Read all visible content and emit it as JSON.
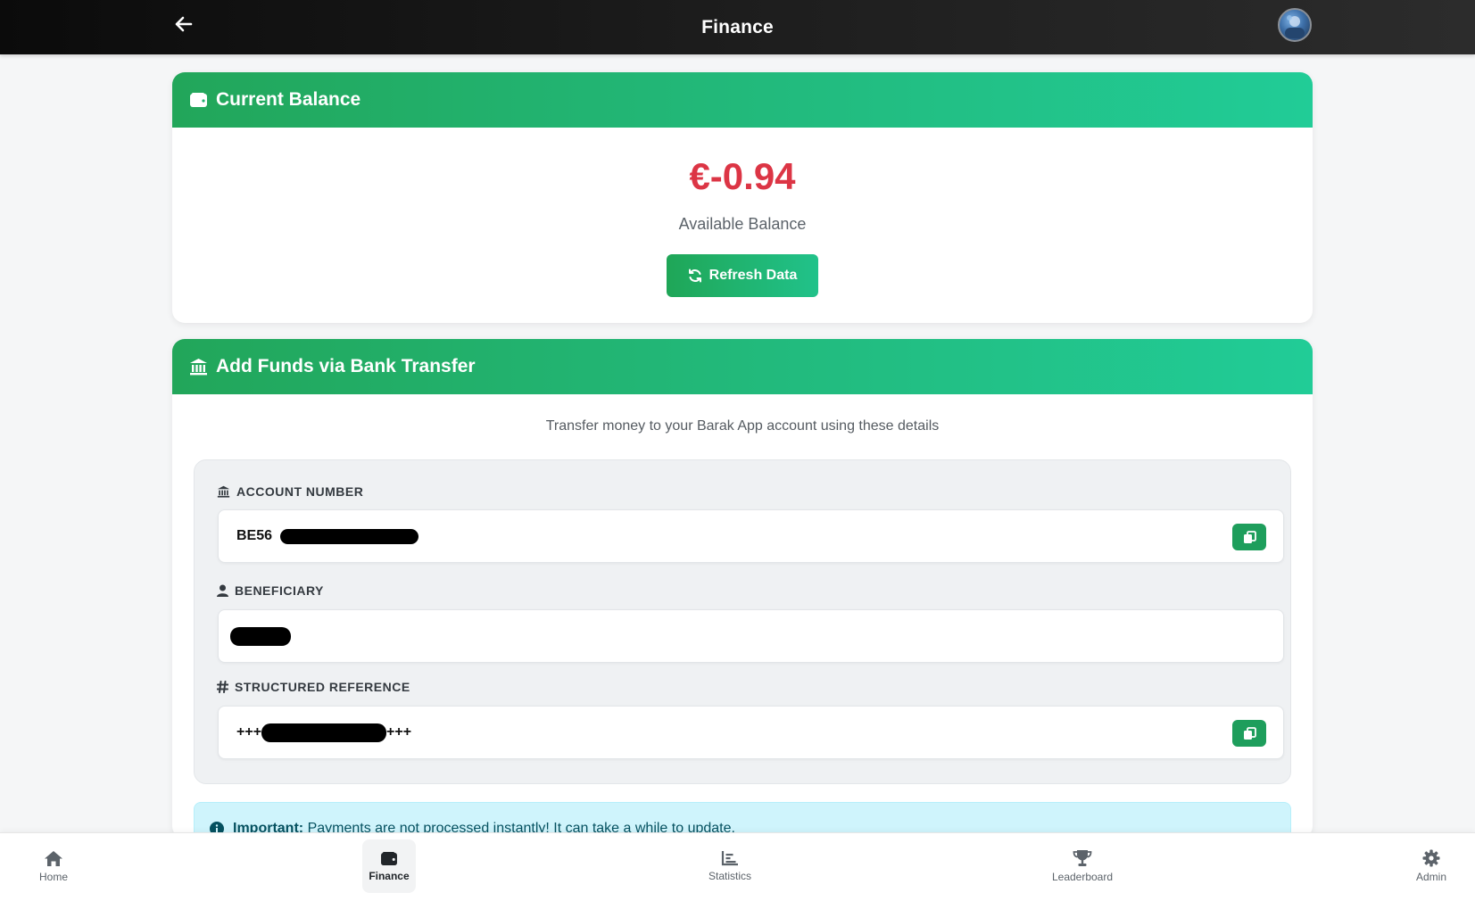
{
  "header": {
    "title": "Finance",
    "back_icon": "arrow-left-icon",
    "avatar_icon": "user-avatar"
  },
  "balance": {
    "title": "Current Balance",
    "icon": "wallet-icon",
    "amount": "€-0.94",
    "amount_color": "#dc3545",
    "label": "Available Balance",
    "refresh_label": "Refresh Data",
    "refresh_icon": "refresh-icon"
  },
  "funds": {
    "title": "Add Funds via Bank Transfer",
    "icon": "bank-icon",
    "subtitle": "Transfer money to your Barak App account using these details",
    "account_number": {
      "label": "ACCOUNT NUMBER",
      "icon": "bank-icon",
      "value_visible": "BE56",
      "copy_icon": "copy-icon"
    },
    "beneficiary": {
      "label": "BENEFICIARY",
      "icon": "user-icon"
    },
    "structured_reference": {
      "label": "STRUCTURED REFERENCE",
      "icon": "hashtag-icon",
      "value_prefix": "+++",
      "value_suffix": "+++",
      "copy_icon": "copy-icon"
    },
    "alert": {
      "icon": "info-icon",
      "strong": "Important:",
      "text": "Payments are not processed instantly! It can take a while to update."
    }
  },
  "nav": {
    "items": [
      {
        "label": "Home",
        "icon": "home-icon",
        "active": false
      },
      {
        "label": "Finance",
        "icon": "wallet-icon",
        "active": true
      },
      {
        "label": "Statistics",
        "icon": "chart-icon",
        "active": false
      },
      {
        "label": "Leaderboard",
        "icon": "trophy-icon",
        "active": false
      },
      {
        "label": "Admin",
        "icon": "gear-icon",
        "active": false
      }
    ]
  },
  "colors": {
    "accent_green": "#22bb7e",
    "button_green": "#1e9e5c",
    "negative": "#dc3545",
    "info_bg": "#cff4fc"
  }
}
